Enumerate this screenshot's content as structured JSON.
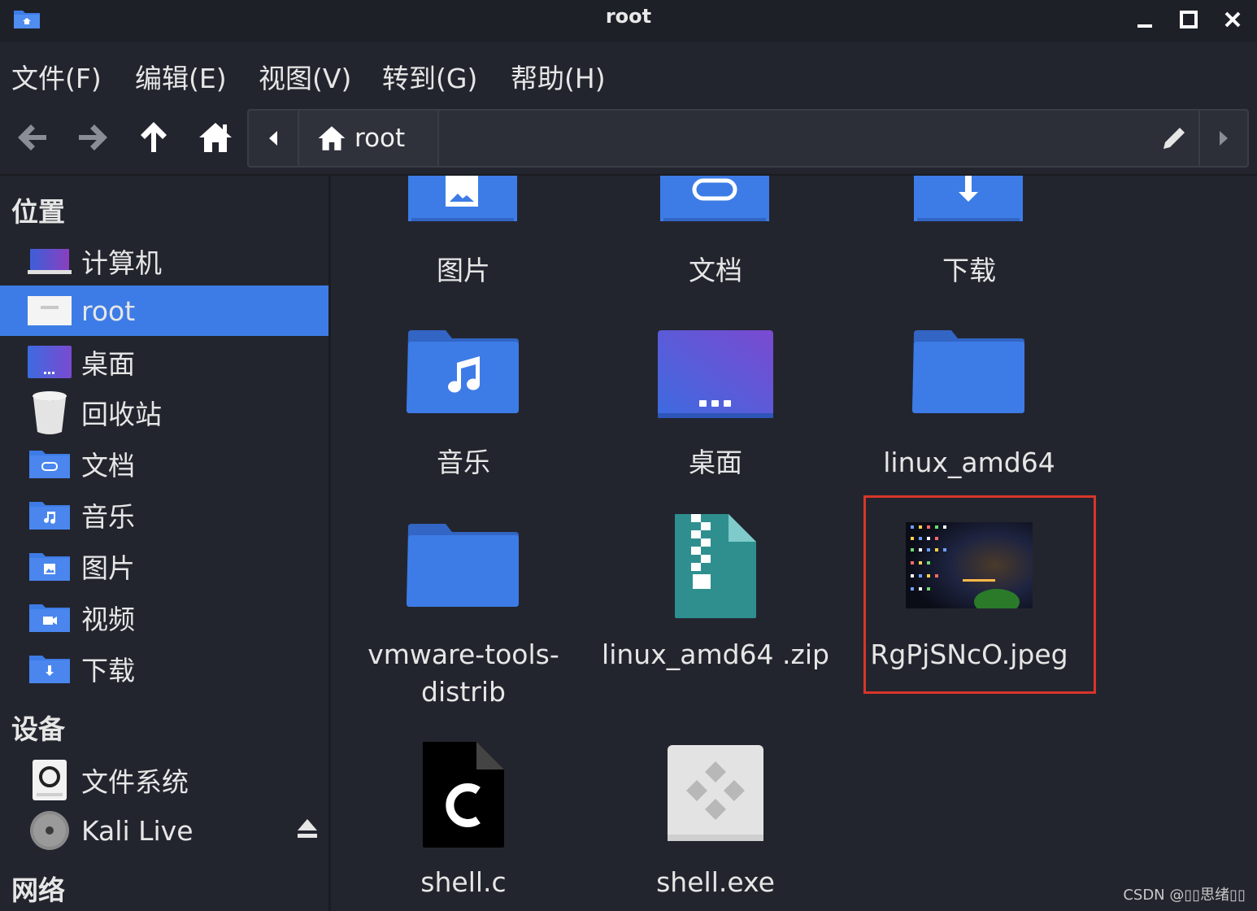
{
  "window": {
    "title": "root"
  },
  "menu": [
    {
      "id": "file",
      "label": "文件(F)"
    },
    {
      "id": "edit",
      "label": "编辑(E)"
    },
    {
      "id": "view",
      "label": "视图(V)"
    },
    {
      "id": "go",
      "label": "转到(G)"
    },
    {
      "id": "help",
      "label": "帮助(H)"
    }
  ],
  "pathbar": {
    "crumb": "root"
  },
  "sidebar": {
    "places_header": "位置",
    "places": [
      {
        "label": "计算机",
        "icon": "computer-icon"
      },
      {
        "label": "root",
        "icon": "home-folder-icon",
        "selected": true
      },
      {
        "label": "桌面",
        "icon": "desktop-icon"
      },
      {
        "label": "回收站",
        "icon": "trash-icon"
      },
      {
        "label": "文档",
        "icon": "documents-folder-icon"
      },
      {
        "label": "音乐",
        "icon": "music-folder-icon"
      },
      {
        "label": "图片",
        "icon": "pictures-folder-icon"
      },
      {
        "label": "视频",
        "icon": "videos-folder-icon"
      },
      {
        "label": "下载",
        "icon": "downloads-folder-icon"
      }
    ],
    "devices_header": "设备",
    "devices": [
      {
        "label": "文件系统",
        "icon": "drive-icon"
      },
      {
        "label": "Kali Live",
        "icon": "optical-disc-icon",
        "ejectable": true
      }
    ],
    "network_header": "网络"
  },
  "files": [
    {
      "name": "图片",
      "icon": "pictures-folder-icon"
    },
    {
      "name": "文档",
      "icon": "documents-folder-icon"
    },
    {
      "name": "下载",
      "icon": "downloads-folder-icon"
    },
    {
      "name": "音乐",
      "icon": "music-folder-icon"
    },
    {
      "name": "桌面",
      "icon": "desktop-icon"
    },
    {
      "name": "linux_amd64",
      "icon": "folder-icon"
    },
    {
      "name": "vmware-tools-distrib",
      "name_lines": [
        "vmware-tools-",
        "distrib"
      ],
      "icon": "folder-icon"
    },
    {
      "name": "linux_amd64 .zip",
      "icon": "zip-archive-icon"
    },
    {
      "name": "RgPjSNcO.jpeg",
      "icon": "image-thumbnail-icon",
      "highlighted": true
    },
    {
      "name": "shell.c",
      "icon": "c-source-icon"
    },
    {
      "name": "shell.exe",
      "icon": "exe-file-icon"
    }
  ],
  "colors": {
    "selection": "#3d7ce6",
    "highlight_box": "#d8352a",
    "folder": "#3d7ce6"
  },
  "watermark": "CSDN @▯▯思绪▯▯"
}
